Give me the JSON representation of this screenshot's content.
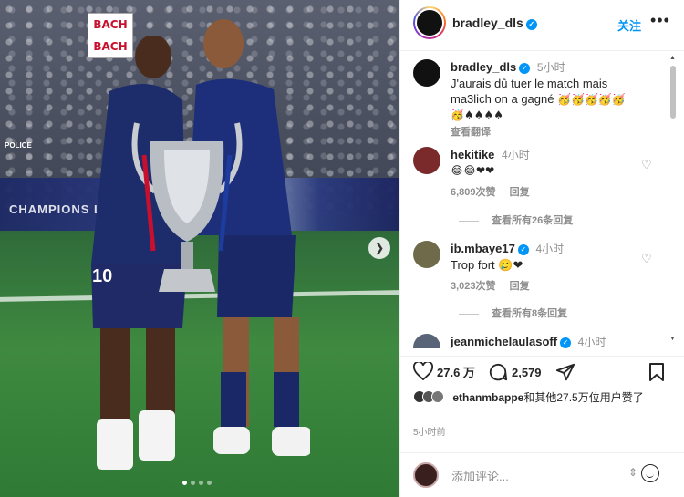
{
  "photo": {
    "banner_line1": "BACH",
    "banner_line2": "BACH",
    "police_label": "POLICE",
    "ad_text": "CHAMPIONS LEAGUE",
    "jersey_number": "10",
    "carousel": {
      "total": 4,
      "active_index": 0
    }
  },
  "header": {
    "username": "bradley_dls",
    "verified": true,
    "follow_label": "关注",
    "more_label": "•••"
  },
  "caption": {
    "username": "bradley_dls",
    "time": "5小时",
    "text_line1": "J'aurais dû tuer le match mais",
    "text_line2": "ma3lich on a gagné",
    "emoji_line1": "🥳🥳🥳🥳🥳",
    "emoji_line2": "🥳♠♠♠♠",
    "translate": "查看翻译"
  },
  "comments": [
    {
      "username": "hekitike",
      "time": "4小时",
      "text": "😂😂❤❤",
      "likes": "6,809次赞",
      "reply": "回复",
      "view_replies": "查看所有26条回复"
    },
    {
      "username": "ib.mbaye17",
      "time": "4小时",
      "text": "Trop fort 🥲❤",
      "likes": "3,023次赞",
      "reply": "回复",
      "view_replies": "查看所有8条回复"
    },
    {
      "username": "jeanmichelaulasoff",
      "time": "4小时"
    }
  ],
  "actions": {
    "like_count": "27.6 万",
    "comment_count": "2,579"
  },
  "liked_by": {
    "user": "ethanmbappe",
    "rest": "和其他27.5万位用户赞了"
  },
  "posted_time": "5小时前",
  "add_comment": {
    "placeholder": "添加评论..."
  }
}
